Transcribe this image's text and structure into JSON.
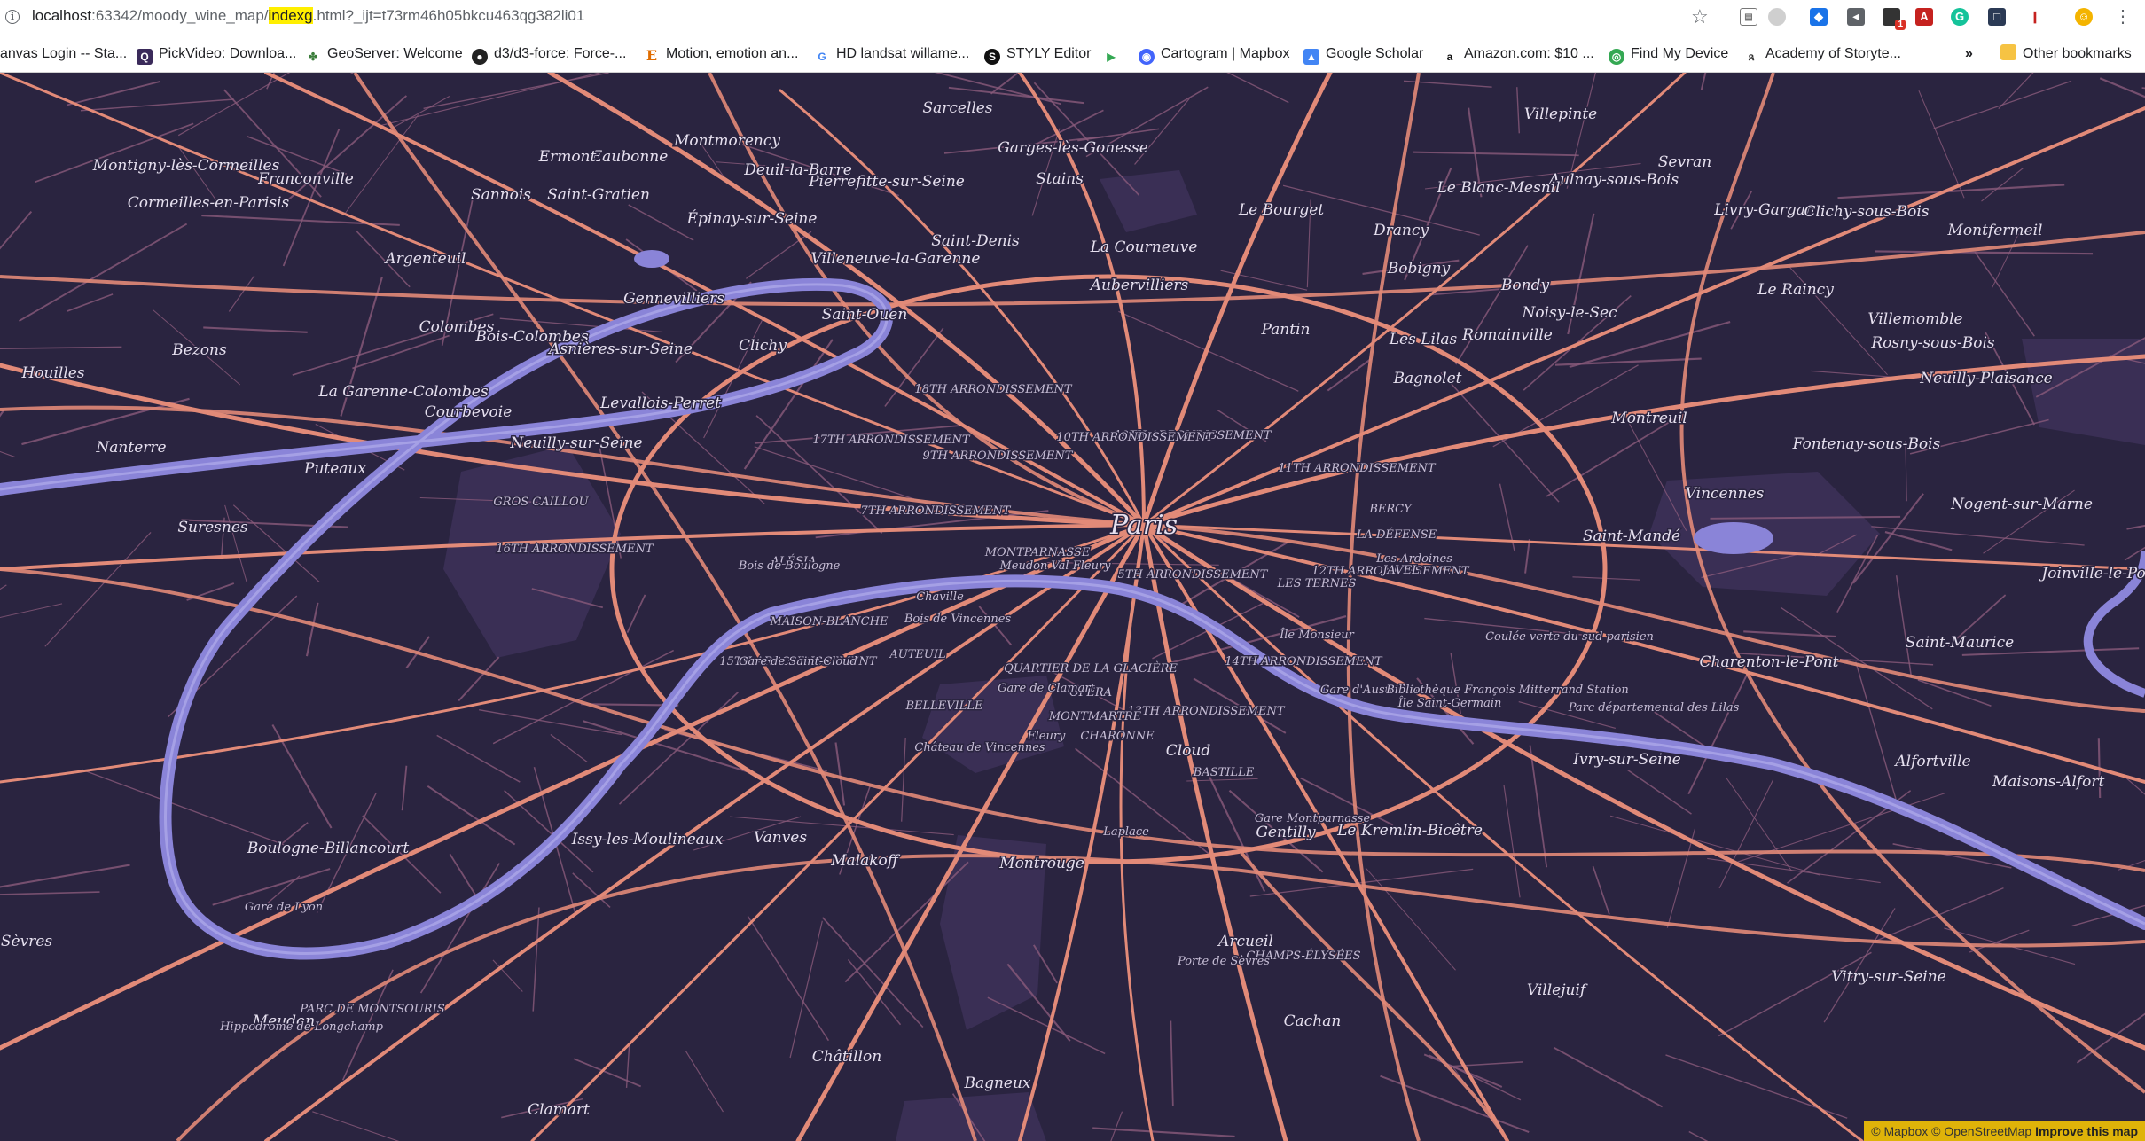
{
  "browser": {
    "url_host": "localhost",
    "url_port_path": ":63342/moody_wine_map/",
    "url_highlight": "indexg",
    "url_rest": ".html?_ijt=t73rm46h05bkcu463qg382li01",
    "extension_badge": "1"
  },
  "bookmarks": [
    {
      "label": "anvas Login -- Sta...",
      "icon": "canvas-icon"
    },
    {
      "label": "PickVideo: Downloa...",
      "icon": "pickvideo-icon"
    },
    {
      "label": "GeoServer: Welcome",
      "icon": "geoserver-icon"
    },
    {
      "label": "d3/d3-force: Force-...",
      "icon": "github-icon"
    },
    {
      "label": "Motion, emotion an...",
      "icon": "e-icon"
    },
    {
      "label": "HD landsat willame...",
      "icon": "google-icon"
    },
    {
      "label": "STYLY Editor",
      "icon": "styly-icon"
    },
    {
      "label": "",
      "icon": "play-icon"
    },
    {
      "label": "Cartogram | Mapbox",
      "icon": "mapbox-icon"
    },
    {
      "label": "Google Scholar",
      "icon": "scholar-icon"
    },
    {
      "label": "Amazon.com: $10 ...",
      "icon": "amazon-icon"
    },
    {
      "label": "Find My Device",
      "icon": "find-device-icon"
    },
    {
      "label": "Academy of Storyte...",
      "icon": "academy-icon"
    }
  ],
  "bookmarks_overflow": "»",
  "other_bookmarks": "Other bookmarks",
  "map": {
    "colors": {
      "background": "#2a2440",
      "water": "#8a84d8",
      "roads": "#e28a78",
      "minor_roads": "#8a5a7a",
      "parks": "#3a2f55"
    },
    "labels": [
      {
        "text": "Paris",
        "size": "big"
      },
      {
        "text": "Argenteuil"
      },
      {
        "text": "Saint-Denis"
      },
      {
        "text": "Aubervilliers"
      },
      {
        "text": "Pantin"
      },
      {
        "text": "Montreuil"
      },
      {
        "text": "Vincennes"
      },
      {
        "text": "Saint-Mandé"
      },
      {
        "text": "Charenton-le-Pont"
      },
      {
        "text": "Saint-Maurice"
      },
      {
        "text": "Ivry-sur-Seine"
      },
      {
        "text": "Vitry-sur-Seine"
      },
      {
        "text": "Villejuif"
      },
      {
        "text": "Le Kremlin-Bicêtre"
      },
      {
        "text": "Gentilly"
      },
      {
        "text": "Arcueil"
      },
      {
        "text": "Cachan"
      },
      {
        "text": "Bagneux"
      },
      {
        "text": "Châtillon"
      },
      {
        "text": "Clamart"
      },
      {
        "text": "Malakoff"
      },
      {
        "text": "Montrouge"
      },
      {
        "text": "Vanves"
      },
      {
        "text": "Issy-les-Moulineaux"
      },
      {
        "text": "Boulogne-Billancourt"
      },
      {
        "text": "Sèvres"
      },
      {
        "text": "Meudon"
      },
      {
        "text": "Suresnes"
      },
      {
        "text": "Puteaux"
      },
      {
        "text": "Nanterre"
      },
      {
        "text": "Courbevoie"
      },
      {
        "text": "Colombes"
      },
      {
        "text": "Bois-Colombes"
      },
      {
        "text": "La Garenne-Colombes"
      },
      {
        "text": "Asnières-sur-Seine"
      },
      {
        "text": "Gennevilliers"
      },
      {
        "text": "Clichy"
      },
      {
        "text": "Levallois-Perret"
      },
      {
        "text": "Neuilly-sur-Seine"
      },
      {
        "text": "Saint-Ouen"
      },
      {
        "text": "Épinay-sur-Seine"
      },
      {
        "text": "Villeneuve-la-Garenne"
      },
      {
        "text": "La Courneuve"
      },
      {
        "text": "Le Bourget"
      },
      {
        "text": "Drancy"
      },
      {
        "text": "Bobigny"
      },
      {
        "text": "Bondy"
      },
      {
        "text": "Noisy-le-Sec"
      },
      {
        "text": "Romainville"
      },
      {
        "text": "Bagnolet"
      },
      {
        "text": "Les Lilas"
      },
      {
        "text": "Rosny-sous-Bois"
      },
      {
        "text": "Fontenay-sous-Bois"
      },
      {
        "text": "Nogent-sur-Marne"
      },
      {
        "text": "Joinville-le-Pont"
      },
      {
        "text": "Maisons-Alfort"
      },
      {
        "text": "Alfortville"
      },
      {
        "text": "Neuilly-Plaisance"
      },
      {
        "text": "Villemomble"
      },
      {
        "text": "Le Raincy"
      },
      {
        "text": "Livry-Gargan"
      },
      {
        "text": "Clichy-sous-Bois"
      },
      {
        "text": "Montfermeil"
      },
      {
        "text": "Aulnay-sous-Bois"
      },
      {
        "text": "Le Blanc-Mesnil"
      },
      {
        "text": "Sevran"
      },
      {
        "text": "Villepinte"
      },
      {
        "text": "Stains"
      },
      {
        "text": "Sarcelles"
      },
      {
        "text": "Garges-lès-Gonesse"
      },
      {
        "text": "Pierrefitte-sur-Seine"
      },
      {
        "text": "Deuil-la-Barre"
      },
      {
        "text": "Montmorency"
      },
      {
        "text": "Eaubonne"
      },
      {
        "text": "Ermont"
      },
      {
        "text": "Sannois"
      },
      {
        "text": "Franconville"
      },
      {
        "text": "Cormeilles-en-Parisis"
      },
      {
        "text": "Montigny-lès-Cormeilles"
      },
      {
        "text": "Saint-Gratien"
      },
      {
        "text": "Bezons"
      },
      {
        "text": "Houilles"
      },
      {
        "text": "18TH ARRONDISSEMENT",
        "size": "small"
      },
      {
        "text": "17TH ARRONDISSEMENT",
        "size": "small"
      },
      {
        "text": "19TH ARRONDISSEMENT",
        "size": "small"
      },
      {
        "text": "10TH ARRONDISSEMENT",
        "size": "small"
      },
      {
        "text": "9TH ARRONDISSEMENT",
        "size": "small"
      },
      {
        "text": "11TH ARRONDISSEMENT",
        "size": "small"
      },
      {
        "text": "16TH ARRONDISSEMENT",
        "size": "small"
      },
      {
        "text": "7TH ARRONDISSEMENT",
        "size": "small"
      },
      {
        "text": "5TH ARRONDISSEMENT",
        "size": "small"
      },
      {
        "text": "12TH ARRONDISSEMENT",
        "size": "small"
      },
      {
        "text": "15TH ARRONDISSEMENT",
        "size": "small"
      },
      {
        "text": "14TH ARRONDISSEMENT",
        "size": "small"
      },
      {
        "text": "13TH ARRONDISSEMENT",
        "size": "small"
      },
      {
        "text": "BELLEVILLE",
        "size": "small"
      },
      {
        "text": "MONTMARTRE",
        "size": "small"
      },
      {
        "text": "OPÉRA",
        "size": "small"
      },
      {
        "text": "BASTILLE",
        "size": "small"
      },
      {
        "text": "BERCY",
        "size": "small"
      },
      {
        "text": "MONTPARNASSE",
        "size": "small"
      },
      {
        "text": "LES TERNES",
        "size": "small"
      },
      {
        "text": "LA DÉFENSE",
        "size": "small"
      },
      {
        "text": "AUTEUIL",
        "size": "small"
      },
      {
        "text": "JAVEL",
        "size": "small"
      },
      {
        "text": "GROS CAILLOU",
        "size": "small"
      },
      {
        "text": "ALÉSIA",
        "size": "small"
      },
      {
        "text": "MAISON-BLANCHE",
        "size": "small"
      },
      {
        "text": "QUARTIER DE LA GLACIÈRE",
        "size": "small"
      },
      {
        "text": "PARC DE MONTSOURIS",
        "size": "small"
      },
      {
        "text": "CHARONNE",
        "size": "small"
      },
      {
        "text": "CHAMPS-ÉLYSÉES",
        "size": "small"
      },
      {
        "text": "Bois de Boulogne",
        "size": "small"
      },
      {
        "text": "Bois de Vincennes",
        "size": "small"
      },
      {
        "text": "Gare de Lyon",
        "size": "small"
      },
      {
        "text": "Gare d'Austerlitz",
        "size": "small"
      },
      {
        "text": "Gare Montparnasse",
        "size": "small"
      },
      {
        "text": "Hippodrome de Longchamp",
        "size": "small"
      },
      {
        "text": "Château de Vincennes",
        "size": "small"
      },
      {
        "text": "Bibliothèque François Mitterrand Station",
        "size": "small"
      },
      {
        "text": "Chaville",
        "size": "small"
      },
      {
        "text": "Fleury",
        "size": "small"
      },
      {
        "text": "Meudon Val Fleury",
        "size": "small"
      },
      {
        "text": "Gare de Clamart",
        "size": "small"
      },
      {
        "text": "Coulée verte du sud parisien",
        "size": "small"
      },
      {
        "text": "Laplace",
        "size": "small"
      },
      {
        "text": "Parc départemental des Lilas",
        "size": "small"
      },
      {
        "text": "Les Ardoines",
        "size": "small"
      },
      {
        "text": "Île Monsieur",
        "size": "small"
      },
      {
        "text": "Île Saint-Germain",
        "size": "small"
      },
      {
        "text": "Gare de Saint-Cloud",
        "size": "small"
      },
      {
        "text": "Cloud"
      },
      {
        "text": "Porte de Sèvres",
        "size": "small"
      }
    ]
  },
  "attribution": {
    "mapbox": "© Mapbox",
    "osm": "© OpenStreetMap",
    "improve": "Improve this map"
  }
}
